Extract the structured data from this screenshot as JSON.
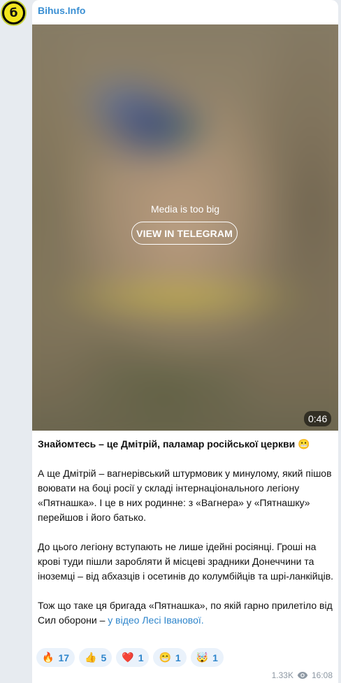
{
  "channel": {
    "name": "Bihus.Info",
    "avatar_glyph": "б"
  },
  "media": {
    "message": "Media is too big",
    "button_label": "VIEW IN TELEGRAM",
    "duration": "0:46"
  },
  "post": {
    "title": "Знайомтесь – це Дмітрій, паламар російської церкви 😬",
    "para1": "А ще Дмітрій – вагнерівський штурмовик у минулому, який пішов воювати на боці росії у складі інтернаціонального легіону «Пятнашка». І це в них родинне: з «Вагнера» у «Пятнашку» перейшов і його батько.",
    "para2": "До цього легіону вступають не лише ідейні росіянці. Гроші на крові туди пішли заробляти й місцеві зрадники Донеччини та іноземці – від абхазців і осетинів до колумбійців та шрі-ланкійців.",
    "para3_text": "Тож що таке ця бригада «Пятнашка», по якій гарно прилетіло від Сил оборони – ",
    "para3_link": "у відео Лесі Іванової."
  },
  "reactions": [
    {
      "emoji": "🔥",
      "count": "17"
    },
    {
      "emoji": "👍",
      "count": "5"
    },
    {
      "emoji": "❤️",
      "count": "1"
    },
    {
      "emoji": "😁",
      "count": "1"
    },
    {
      "emoji": "🤯",
      "count": "1"
    }
  ],
  "footer": {
    "views": "1.33K",
    "time": "16:08"
  }
}
